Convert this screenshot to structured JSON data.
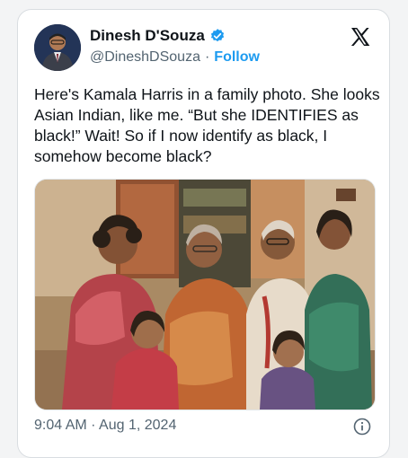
{
  "author": {
    "name": "Dinesh D'Souza",
    "handle": "@DineshDSouza",
    "separator": "·",
    "follow_label": "Follow",
    "verified": true
  },
  "tweet": {
    "text": "Here's Kamala Harris in a family photo. She looks Asian Indian, like me. “But she IDENTIFIES as black!” Wait! So if I now identify as black, I somehow become black?"
  },
  "photo": {
    "kind": "vintage family photo",
    "people_count": 5
  },
  "meta": {
    "time": "9:04 AM",
    "separator": "·",
    "date": "Aug 1, 2024"
  },
  "icons": {
    "verified": "verified-badge-icon",
    "platform": "x-logo-icon",
    "info": "info-icon"
  },
  "colors": {
    "link": "#1d9bf0",
    "text": "#0f1419",
    "muted": "#536471"
  }
}
